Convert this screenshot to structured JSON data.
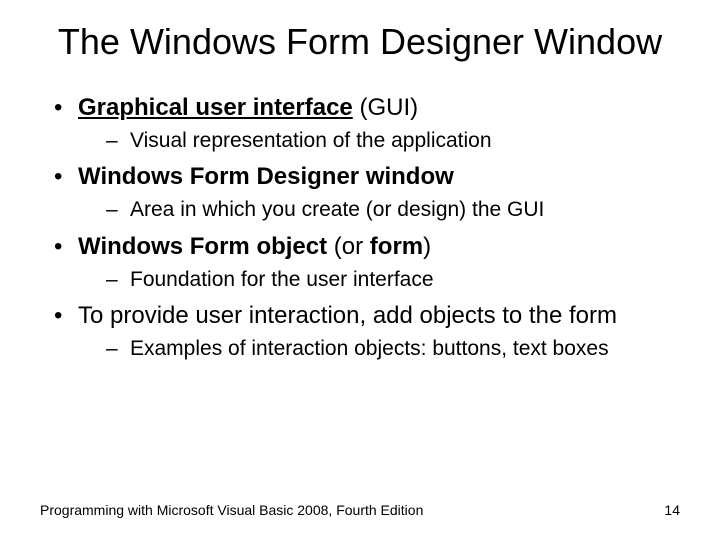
{
  "title": "The Windows Form Designer Window",
  "bullets": {
    "b1_pre": "Graphical user interface",
    "b1_post": " (GUI)",
    "b1_sub": "Visual representation of the application",
    "b2": "Windows Form Designer window",
    "b2_sub": "Area in which you create (or design) the GUI",
    "b3_pre": "Windows Form object",
    "b3_mid": " (or ",
    "b3_form": "form",
    "b3_post": ")",
    "b3_sub": "Foundation for the user interface",
    "b4": "To provide user interaction, add objects to the form",
    "b4_sub": "Examples of interaction objects: buttons, text boxes"
  },
  "footer": {
    "left": "Programming with Microsoft Visual Basic 2008, Fourth Edition",
    "right": "14"
  }
}
